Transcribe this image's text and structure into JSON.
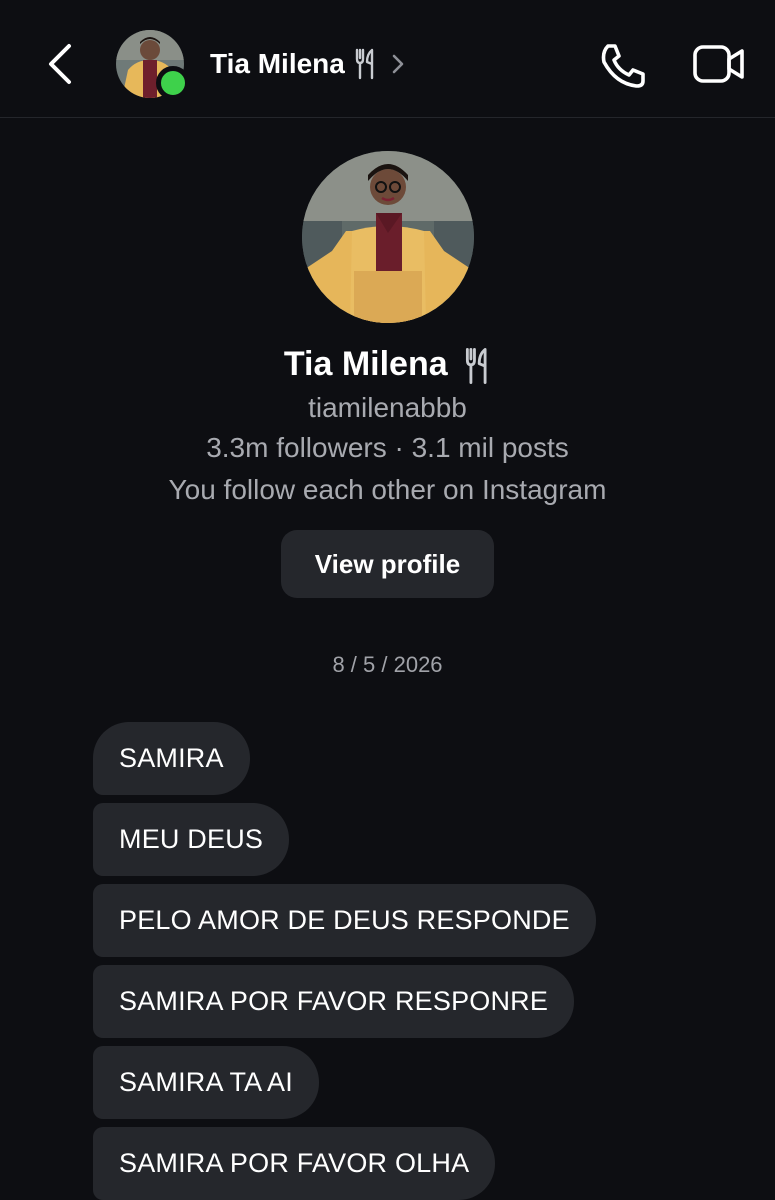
{
  "header": {
    "name": "Tia Milena",
    "name_emoji_icon": "fork-knife-icon",
    "back_icon": "chevron-left-icon",
    "chevron_icon": "chevron-right-icon",
    "call_icon": "phone-icon",
    "video_icon": "video-camera-icon",
    "online_color": "#3ed14b"
  },
  "profile": {
    "name": "Tia Milena",
    "username": "tiamilenabbb",
    "stats": "3.3m followers · 3.1 mil posts",
    "mutual": "You follow each other on Instagram",
    "view_profile_label": "View profile"
  },
  "thread": {
    "date": "8 / 5 / 2026",
    "messages": [
      "SAMIRA",
      "MEU DEUS",
      "PELO AMOR DE DEUS RESPONDE",
      "SAMIRA POR FAVOR RESPONRE",
      "SAMIRA TA AI",
      "SAMIRA POR FAVOR OLHA"
    ]
  },
  "colors": {
    "background": "#0d0e12",
    "bubble": "#25272c",
    "secondary_text": "#a8aab0"
  }
}
